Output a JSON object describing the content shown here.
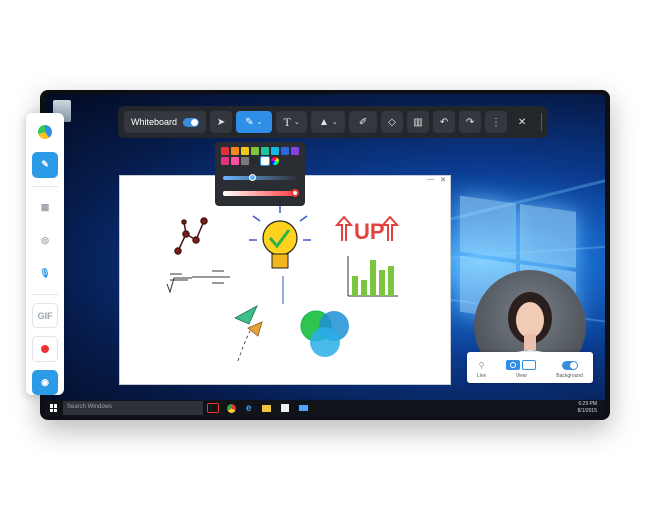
{
  "toolbar": {
    "whiteboard_label": "Whiteboard",
    "text_tool_glyph": "T",
    "close_glyph": "✕"
  },
  "palette": {
    "colors": [
      "#e0313a",
      "#f08a1c",
      "#f2c71b",
      "#7cc540",
      "#21c39a",
      "#19b7e8",
      "#2d68e2",
      "#8a3fe0",
      "#e0347f",
      "#ff4fa3",
      "#7a7a7a",
      "#2b2b2b",
      "#ffffff"
    ],
    "opacity_level": 0.38,
    "size_level": 1.0
  },
  "side_panel": {
    "gif_label": "GIF"
  },
  "camera_controls": {
    "live_label": "Live",
    "view_label": "View",
    "background_label": "Background"
  },
  "taskbar": {
    "search_placeholder": "Search Windows",
    "time": "6:29 PM",
    "date": "8/1/2015"
  },
  "accent_color": "#2f8fe6"
}
